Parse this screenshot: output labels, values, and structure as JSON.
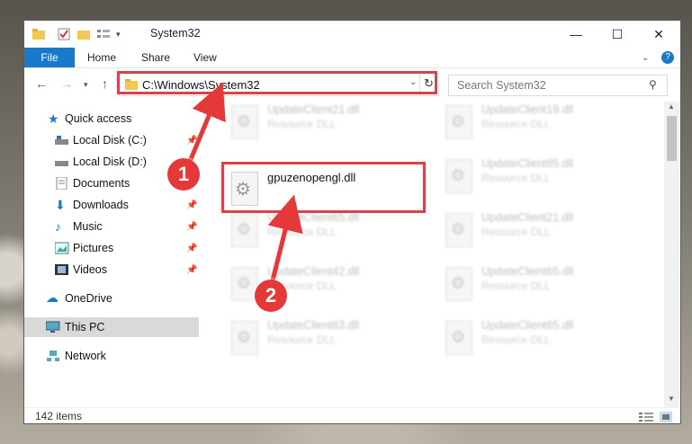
{
  "window": {
    "title": "System32"
  },
  "controls": {
    "minimize": "—",
    "maximize": "☐",
    "close": "✕"
  },
  "ribbon": {
    "file": "File",
    "home": "Home",
    "share": "Share",
    "view": "View"
  },
  "address": {
    "path": "C:\\Windows\\System32",
    "search_placeholder": "Search System32"
  },
  "sidebar": {
    "quick_access": "Quick access",
    "items": [
      "Local Disk (C:)",
      "Local Disk (D:)",
      "Documents",
      "Downloads",
      "Music",
      "Pictures",
      "Videos"
    ],
    "onedrive": "OneDrive",
    "thispc": "This PC",
    "network": "Network"
  },
  "files": {
    "highlighted": "gpuzenopengl.dll",
    "col1": [
      "UpdateClient21.dll",
      "UpdateClient65.dll",
      "UpdateClient42.dll",
      "UpdateClient63.dll"
    ],
    "col2": [
      "UpdateClient19.dll",
      "UpdateClient65.dll",
      "UpdateClient21.dll",
      "UpdateClient65.dll",
      "UpdateClient65.dll"
    ],
    "type": "Resource DLL"
  },
  "status": {
    "items": "142 items"
  },
  "annotations": {
    "step1": "1",
    "step2": "2",
    "accent": "#e53838"
  }
}
